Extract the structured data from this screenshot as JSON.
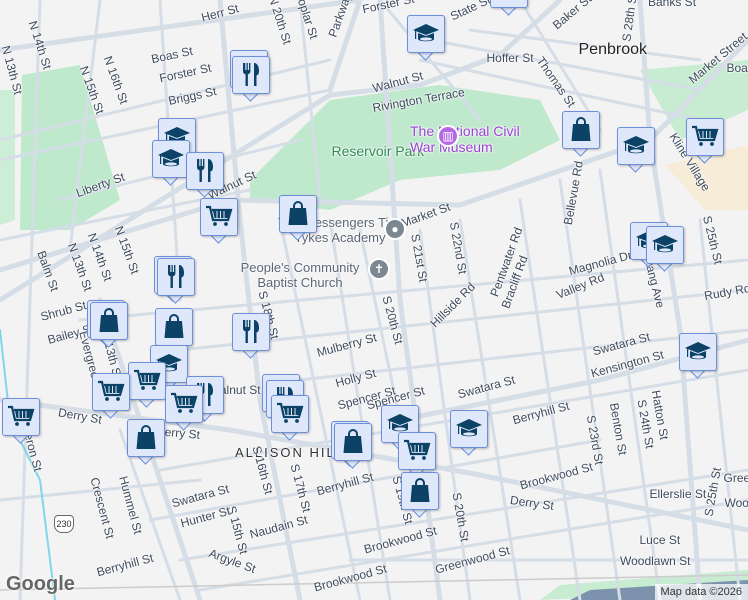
{
  "map": {
    "labels": [
      "Herr St",
      "N 13th St",
      "N 14th St",
      "N 15th St",
      "N 16th St",
      "Boas St",
      "Forster St",
      "Briggs St",
      "N 20th St",
      "Poplar St",
      "Parkway",
      "Forster St",
      "State St",
      "Baker St",
      "S 28th St",
      "Banks St",
      "Penbrook",
      "Hoffer St",
      "Thomas St",
      "Walnut St",
      "Rivington Terrace",
      "Market Street",
      "Boas",
      "Reservoir Park",
      "The National Civil War Museum",
      "Kline Village",
      "Liberty St",
      "Walnut St",
      "The Messengers Tiny Tykes Academy",
      "People's Community Baptist Church",
      "Market St",
      "N 15th St",
      "N 14th St",
      "N 13th St",
      "Balm St",
      "S 21st St",
      "S 22nd St",
      "Bellevue Rd",
      "Pentwater Rd",
      "Bracliff Rd",
      "Hillside Rd",
      "Magnolia Dr",
      "Valley Rd",
      "S 25th St",
      "Rudy Rd",
      "Paxtang Ave",
      "Shrub St",
      "Bailey St",
      "S 18th St",
      "Mulberry St",
      "S 20th St",
      "Holly St",
      "Spencer St",
      "Swatara St",
      "Kensington St",
      "Swatara St",
      "Berryhill St",
      "S 23rd St",
      "Benton St",
      "S 24th St",
      "Hatton St",
      "Brookwood St",
      "Ellerslie St",
      "S 25th St",
      "Green",
      "Wood",
      "Derry St",
      "Luce St",
      "Woodlawn St",
      "Greenwood St",
      "S 20th St",
      "S 19th St",
      "Brookwood St",
      "ALLISON HILL",
      "Derry St",
      "Derry St",
      "S 17th St",
      "S 16th St",
      "S 15th St",
      "Swatara St",
      "Hunter St",
      "Naudain St",
      "Argyle St",
      "Brookwood St",
      "Berryhill St",
      "Berryhill St",
      "Crescent St",
      "Hummel St",
      "S 13th St",
      "Cameron St",
      "Evergreen St",
      "Walnut St",
      "Spencer St"
    ],
    "route_shield": "230",
    "markers": [
      {
        "type": "school"
      },
      {
        "type": "restaurant"
      },
      {
        "type": "restaurant"
      },
      {
        "type": "school"
      },
      {
        "type": "school"
      },
      {
        "type": "restaurant"
      },
      {
        "type": "cart"
      },
      {
        "type": "shop"
      },
      {
        "type": "restaurant"
      },
      {
        "type": "restaurant"
      },
      {
        "type": "shop"
      },
      {
        "type": "shop"
      },
      {
        "type": "shop"
      },
      {
        "type": "restaurant"
      },
      {
        "type": "school"
      },
      {
        "type": "cart"
      },
      {
        "type": "cart"
      },
      {
        "type": "restaurant"
      },
      {
        "type": "cart"
      },
      {
        "type": "restaurant"
      },
      {
        "type": "restaurant"
      },
      {
        "type": "cart"
      },
      {
        "type": "cart"
      },
      {
        "type": "shop"
      },
      {
        "type": "shop"
      },
      {
        "type": "shop"
      },
      {
        "type": "school"
      },
      {
        "type": "cart"
      },
      {
        "type": "shop"
      },
      {
        "type": "school"
      },
      {
        "type": "shop"
      },
      {
        "type": "school"
      },
      {
        "type": "cart"
      },
      {
        "type": "school"
      },
      {
        "type": "school"
      },
      {
        "type": "school"
      },
      {
        "type": "school"
      }
    ],
    "attribution": "Map data ©2026",
    "logo": "Google",
    "colors": {
      "marker_fill": "#dfe8fb",
      "marker_border": "#6d8fd8",
      "icon": "#0b4266",
      "park": "#bfe9cc",
      "road": "#d5dde6"
    }
  }
}
